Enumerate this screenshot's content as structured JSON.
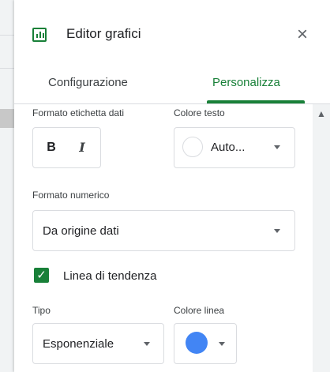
{
  "panel": {
    "title": "Editor grafici",
    "close_glyph": "×",
    "icon": "chart-icon",
    "accent_color": "#188038"
  },
  "tabs": [
    {
      "label": "Configurazione",
      "active": false
    },
    {
      "label": "Personalizza",
      "active": true
    }
  ],
  "data_label_format": {
    "label": "Formato etichetta dati",
    "bold_glyph": "B",
    "italic_glyph": "I"
  },
  "text_color": {
    "label": "Colore testo",
    "value": "Auto..."
  },
  "number_format": {
    "label": "Formato numerico",
    "value": "Da origine dati"
  },
  "trendline": {
    "label": "Linea di tendenza",
    "checked": true,
    "check_glyph": "✓"
  },
  "trend_type": {
    "label": "Tipo",
    "value": "Esponenziale"
  },
  "line_color": {
    "label": "Colore linea",
    "color": "#4285f4"
  },
  "scrollbar": {
    "up_glyph": "▲"
  }
}
